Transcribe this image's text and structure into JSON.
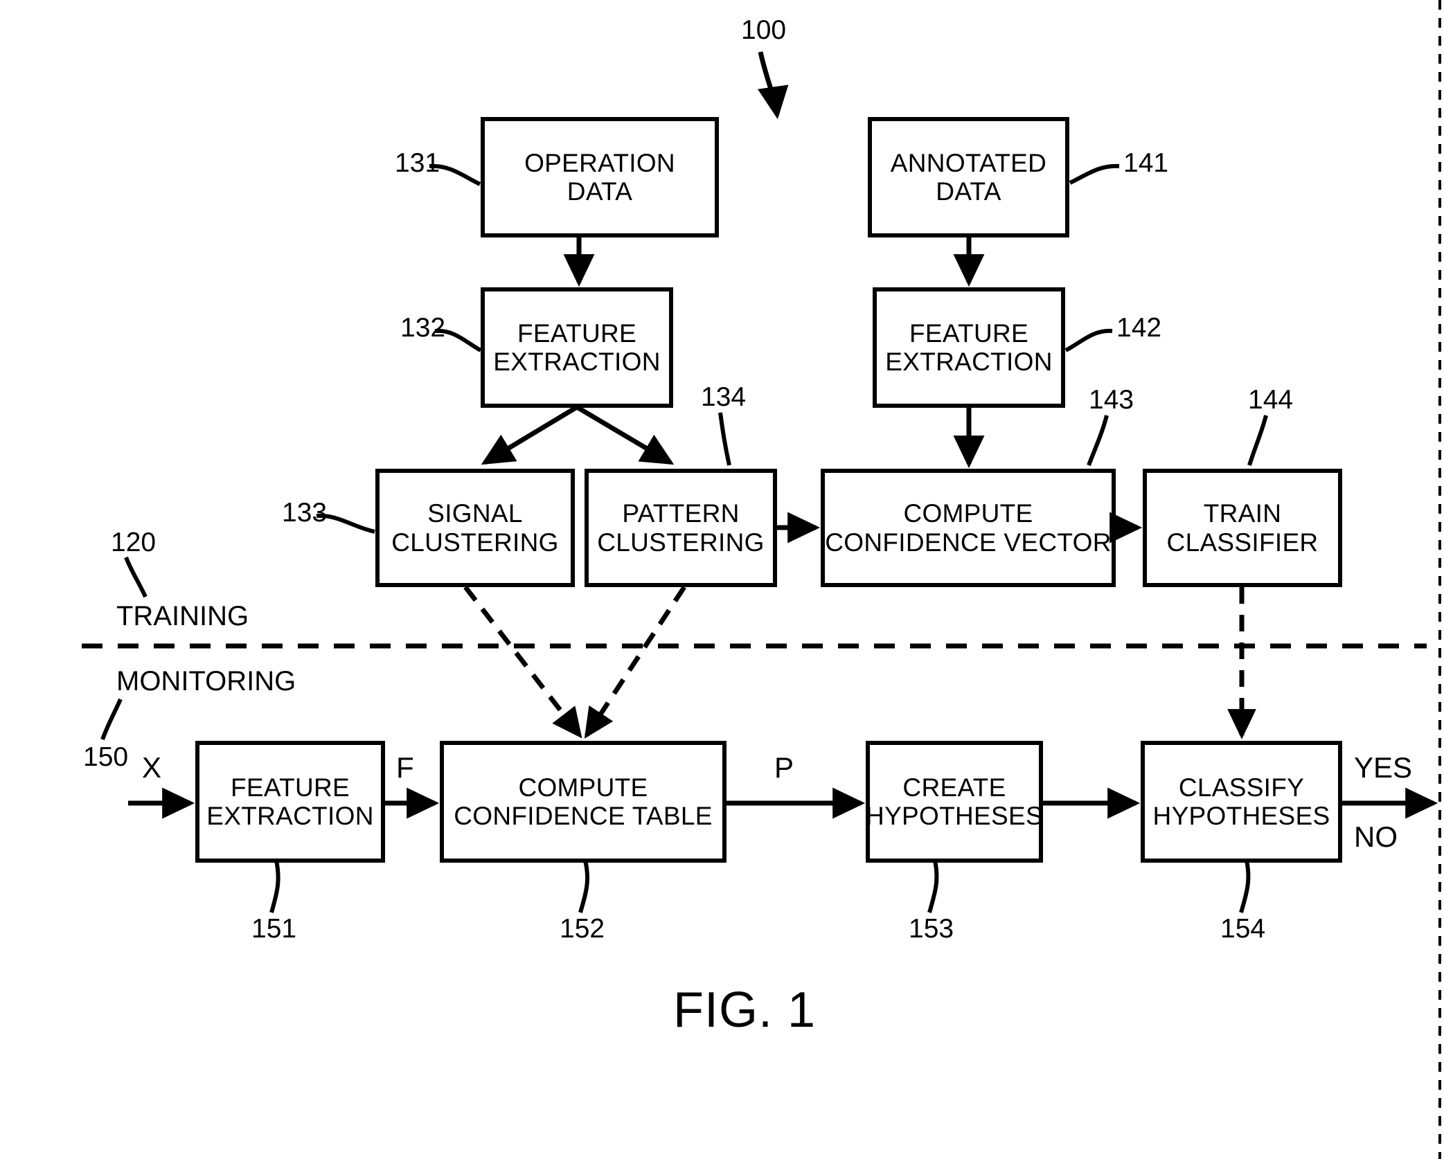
{
  "figure": {
    "caption": "FIG. 1",
    "system_ref": "100"
  },
  "phases": {
    "training": {
      "label": "TRAINING",
      "ref": "120"
    },
    "monitoring": {
      "label": "MONITORING",
      "ref": "150"
    }
  },
  "boxes": {
    "operation_data": {
      "line1": "OPERATION",
      "line2": "DATA",
      "ref": "131"
    },
    "feature_extraction_op": {
      "line1": "FEATURE",
      "line2": "EXTRACTION",
      "ref": "132"
    },
    "signal_clustering": {
      "line1": "SIGNAL",
      "line2": "CLUSTERING",
      "ref": "133"
    },
    "pattern_clustering": {
      "line1": "PATTERN",
      "line2": "CLUSTERING",
      "ref": "134"
    },
    "annotated_data": {
      "line1": "ANNOTATED",
      "line2": "DATA",
      "ref": "141"
    },
    "feature_extraction_ann": {
      "line1": "FEATURE",
      "line2": "EXTRACTION",
      "ref": "142"
    },
    "compute_confidence_vector": {
      "line1": "COMPUTE",
      "line2": "CONFIDENCE VECTOR",
      "ref": "143"
    },
    "train_classifier": {
      "line1": "TRAIN",
      "line2": "CLASSIFIER",
      "ref": "144"
    },
    "feature_extraction_mon": {
      "line1": "FEATURE",
      "line2": "EXTRACTION",
      "ref": "151"
    },
    "compute_confidence_table": {
      "line1": "COMPUTE",
      "line2": "CONFIDENCE TABLE",
      "ref": "152"
    },
    "create_hypotheses": {
      "line1": "CREATE",
      "line2": "HYPOTHESES",
      "ref": "153"
    },
    "classify_hypotheses": {
      "line1": "CLASSIFY",
      "line2": "HYPOTHESES",
      "ref": "154"
    }
  },
  "signals": {
    "input_x": "X",
    "features_f": "F",
    "probabilities_p": "P",
    "output_yes": "YES",
    "output_no": "NO"
  },
  "colors": {
    "stroke": "#000000",
    "background": "#ffffff"
  }
}
